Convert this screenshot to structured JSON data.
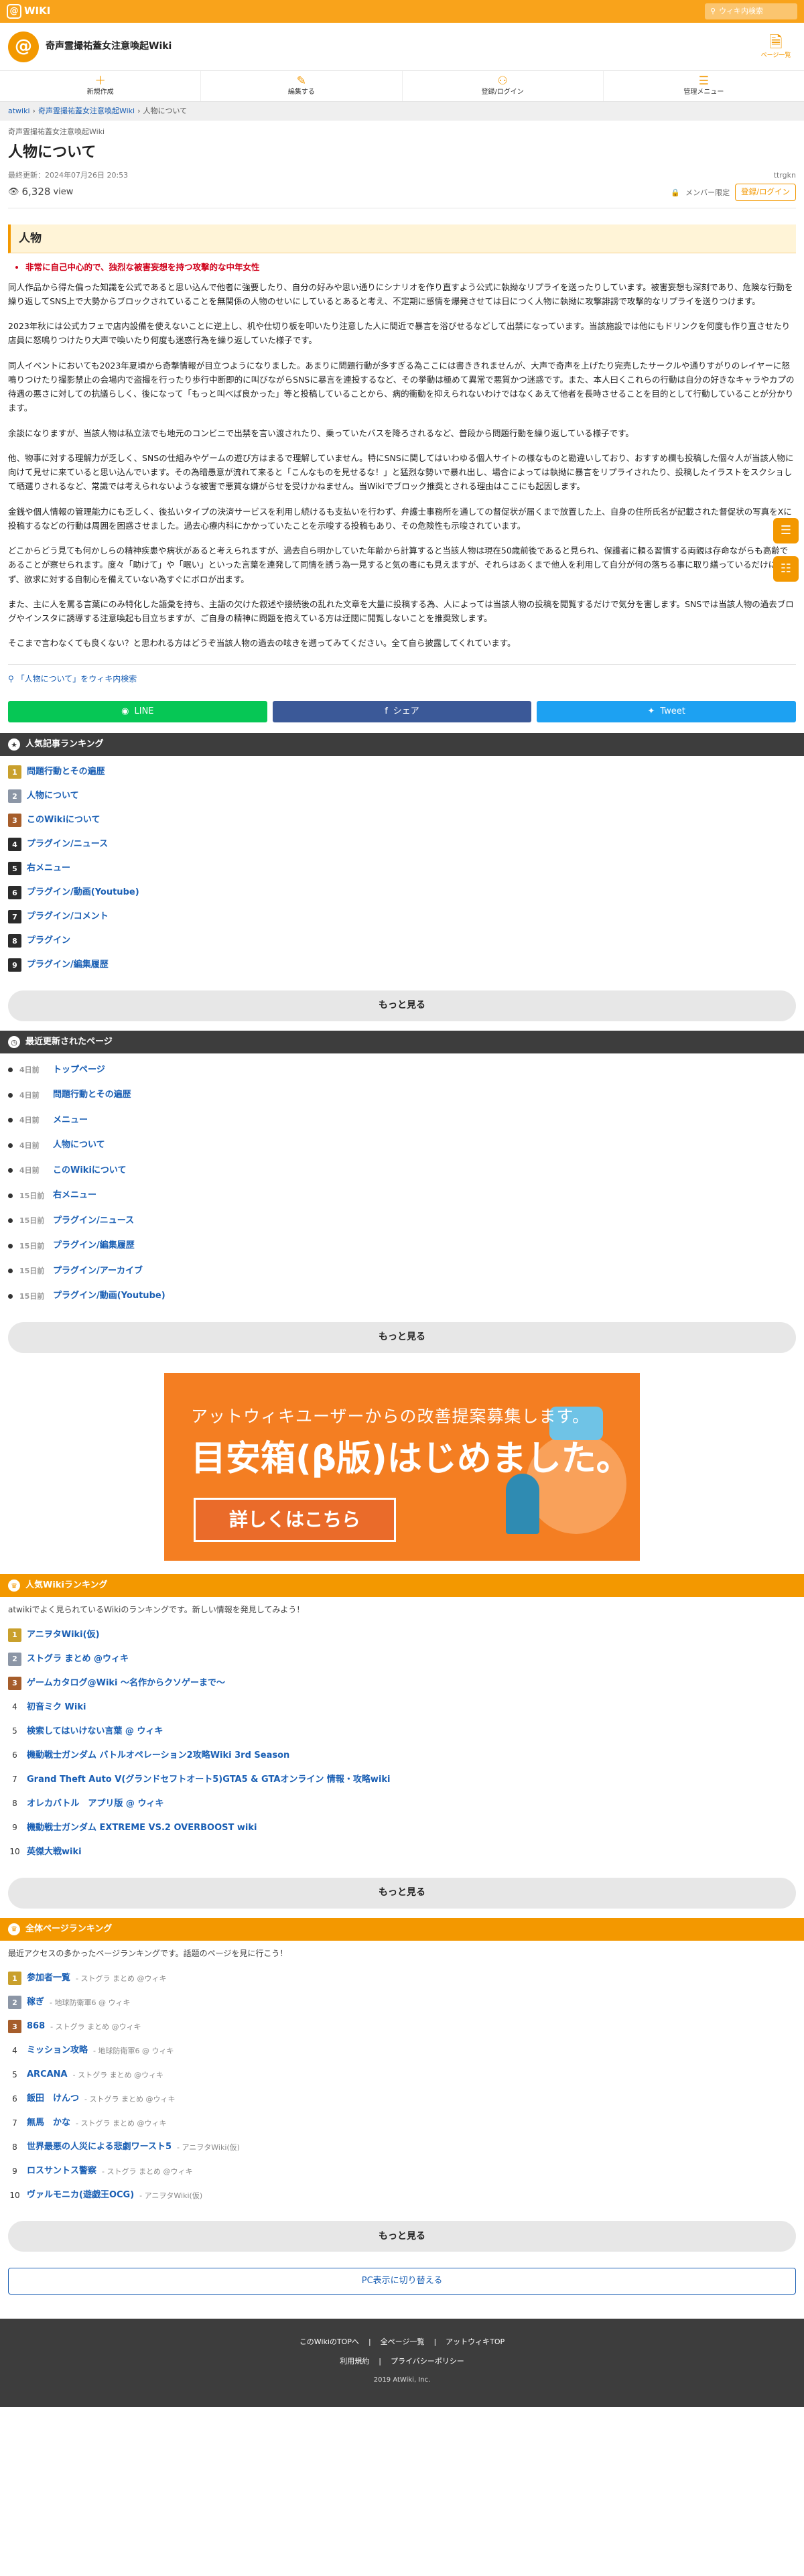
{
  "topbar": {
    "logo_text": "WIKI",
    "search_placeholder": "ウィキ内検索"
  },
  "wiki": {
    "title": "奇声霊撮祐蓋女注意喚起Wiki",
    "menu_label": "ページ一覧"
  },
  "actions": [
    {
      "label": "新規作成",
      "icon": "＋"
    },
    {
      "label": "編集する",
      "icon": "✎"
    },
    {
      "label": "登録/ログイン",
      "icon": "⚇"
    },
    {
      "label": "管理メニュー",
      "icon": "☰"
    }
  ],
  "breadcrumb": {
    "home": "atwiki",
    "sep": "›",
    "wiki": "奇声霊撮祐蓋女注意喚起Wiki",
    "current": "人物について"
  },
  "page": {
    "subtitle": "奇声霊撮祐蓋女注意喚起Wiki",
    "title": "人物について",
    "updated": "最終更新：2024年07月26日 20:53",
    "author": "ttrgkn",
    "views": "6,328",
    "views_unit": "view",
    "member_label": "メンバー限定",
    "login_label": "登録/ログイン",
    "section": "人物",
    "bullet": "非常に自己中心的で、独烈な被害妄想を持つ攻撃的な中年女性",
    "paragraphs": [
      "同人作品から得た偏った知識を公式であると思い込んで他者に強要したり、自分の好みや思い通りにシナリオを作り直すよう公式に執拗なリプライを送ったりしています。被害妄想も深刻であり、危険な行動を繰り返してSNS上で大勢からブロックされていることを無関係の人物のせいにしているとあると考え、不定期に感情を爆発させては日につく人物に執拗に攻撃誹謗で攻撃的なリプライを送りつけます。",
      "2023年秋には公式カフェで店内設備を使えないことに逆上し、机や仕切り板を叩いたり注意した人に間近で暴言を浴びせるなどして出禁になっています。当該施設では他にもドリンクを何度も作り直させたり店員に怒鳴りつけたり大声で喚いたり何度も迷惑行為を繰り返していた様子です。",
      "同人イベントにおいても2023年夏頃から奇撃情報が目立つようになりました。あまりに問題行動が多すぎる為ここには書ききれませんが、大声で奇声を上げたり完売したサークルや通りすがりのレイヤーに怒鳴りつけたり撮影禁止の会場内で盗撮を行ったり歩行中断即的に叫びながらSNSに暴言を連投するなど、その挙動は極めて異常で悪質かつ迷惑です。また、本人曰くこれらの行動は自分の好きなキャラやカプの待遇の悪さに対しての抗議らしく、後になって「もっと叫べば良かった」等と投稿していることから、病的衝動を抑えられないわけではなくあえて他者を長時させることを目的として行動していることが分かります。",
      "余談になりますが、当該人物は私立法でも地元のコンビニで出禁を言い渡されたり、乗っていたバスを降ろされるなど、普段から問題行動を繰り返している様子です。",
      "他、物事に対する理解力が乏しく、SNSの仕組みやゲームの遊び方はまるで理解していません。特にSNSに関してはいわゆる個人サイトの様なものと勘違いしており、おすすめ欄も投稿した個々人が当該人物に向けて見せに来ていると思い込んでいます。その為暗愚意が流れて来ると「こんなものを見せるな！」と猛烈な勢いで暴れ出し、場合によっては執拗に暴言をリプライされたり、投稿したイラストをスクショして晒選りされるなど、常識では考えられないような被害で悪質な嫌がらせを受けかねません。当Wikiでブロック推奨とされる理由はここにも起因します。",
      "金銭や個人情報の管理能力にも乏しく、後払いタイプの決済サービスを利用し続けるも支払いを行わず、弁護士事務所を通しての督促状が届くまで放置した上、自身の住所氏名が記載された督促状の写真をXに投稿するなどの行動は周囲を困惑させました。過去心療内科にかかっていたことを示唆する投稿もあり、その危険性も示唆されています。",
      "どこからどう見ても何かしらの精神疾患や病状があると考えられますが、過去自ら明かしていた年齢から計算すると当該人物は現在50歳前後であると見られ、保護者に頼る習慣する両親は存命ながらも高齢であることが察せられます。度々「助けて」や「眠い」といった言葉を連発して同情を誘う為一見すると気の毒にも見えますが、それらはあくまで他人を利用して自分が何の落ちる事に取り繕っているだけにすぎず、欲求に対する自制心を備えていない為すぐにボロが出ます。",
      "また、主に人を罵る言葉にのみ特化した語彙を持ち、主語の欠けた叙述や接続後の乱れた文章を大量に投稿する為、人によっては当該人物の投稿を閲覧するだけで気分を害します。SNSでは当該人物の過去ブログやインスタに誘導する注意喚起も目立ちますが、ご自身の精神に問題を抱えている方は迂闊に閲覧しないことを推奨致します。",
      "そこまで言わなくても良くない？と思われる方はどうぞ当該人物の過去の呟きを遡ってみてください。全て自ら披露してくれています。"
    ],
    "search_link": "「人物について」をウィキ内検索"
  },
  "share": {
    "line": "LINE",
    "facebook": "シェア",
    "twitter": "Tweet"
  },
  "popular": {
    "heading": "人気記事ランキング",
    "items": [
      "問題行動とその遍歴",
      "人物について",
      "このWikiについて",
      "プラグイン/ニュース",
      "右メニュー",
      "プラグイン/動画(Youtube)",
      "プラグイン/コメント",
      "プラグイン",
      "プラグイン/編集履歴"
    ],
    "more": "もっと見る"
  },
  "recent": {
    "heading": "最近更新されたページ",
    "items": [
      {
        "ago": "4日前",
        "title": "トップページ"
      },
      {
        "ago": "4日前",
        "title": "問題行動とその遍歴"
      },
      {
        "ago": "4日前",
        "title": "メニュー"
      },
      {
        "ago": "4日前",
        "title": "人物について"
      },
      {
        "ago": "4日前",
        "title": "このWikiについて"
      },
      {
        "ago": "15日前",
        "title": "右メニュー"
      },
      {
        "ago": "15日前",
        "title": "プラグイン/ニュース"
      },
      {
        "ago": "15日前",
        "title": "プラグイン/編集履歴"
      },
      {
        "ago": "15日前",
        "title": "プラグイン/アーカイブ"
      },
      {
        "ago": "15日前",
        "title": "プラグイン/動画(Youtube)"
      }
    ],
    "more": "もっと見る"
  },
  "banner": {
    "line1": "アットウィキユーザーからの改善提案募集します。",
    "line2": "目安箱(β版)はじめました。",
    "button": "詳しくはこちら"
  },
  "wiki_rank": {
    "heading": "人気Wikiランキング",
    "intro": "atwikiでよく見られているWikiのランキングです。新しい情報を発見してみよう！",
    "items": [
      "アニヲタWiki(仮)",
      "ストグラ まとめ @ウィキ",
      "ゲームカタログ@Wiki ～名作からクソゲーまで～",
      "初音ミク Wiki",
      "検索してはいけない言葉 @ ウィキ",
      "機動戦士ガンダム バトルオペレーション2攻略Wiki 3rd Season",
      "Grand Theft Auto V(グランドセフトオート5)GTA5 & GTAオンライン 情報・攻略wiki",
      "オレカバトル　アプリ版 @ ウィキ",
      "機動戦士ガンダム EXTREME VS.2 OVERBOOST wiki",
      "英傑大戦wiki"
    ],
    "more": "もっと見る"
  },
  "page_rank": {
    "heading": "全体ページランキング",
    "intro": "最近アクセスの多かったページランキングです。話題のページを見に行こう！",
    "items": [
      {
        "title": "参加者一覧",
        "wiki": "ストグラ まとめ @ウィキ"
      },
      {
        "title": "稼ぎ",
        "wiki": "地球防衛軍6 @ ウィキ"
      },
      {
        "title": "868",
        "wiki": "ストグラ まとめ @ウィキ"
      },
      {
        "title": "ミッション攻略",
        "wiki": "地球防衛軍6 @ ウィキ"
      },
      {
        "title": "ARCANA",
        "wiki": "ストグラ まとめ @ウィキ"
      },
      {
        "title": "飯田　けんつ",
        "wiki": "ストグラ まとめ @ウィキ"
      },
      {
        "title": "無馬　かな",
        "wiki": "ストグラ まとめ @ウィキ"
      },
      {
        "title": "世界最悪の人災による悲劇ワースト5",
        "wiki": "アニヲタWiki(仮)"
      },
      {
        "title": "ロスサントス警察",
        "wiki": "ストグラ まとめ @ウィキ"
      },
      {
        "title": "ヴァルモニカ(遊戯王OCG)",
        "wiki": "アニヲタWiki(仮)"
      }
    ],
    "more": "もっと見る"
  },
  "pc_view": "PC表示に切り替える",
  "footer": {
    "links": [
      "このWikiのTOPへ",
      "全ページ一覧",
      "アットウィキTOP"
    ],
    "links2": [
      "利用規約",
      "プライバシーポリシー"
    ],
    "copyright": "2019 AtWiki, Inc."
  },
  "colors": {
    "accent": "#f39800",
    "link": "#1a5fb4",
    "warning": "#d0021b"
  }
}
